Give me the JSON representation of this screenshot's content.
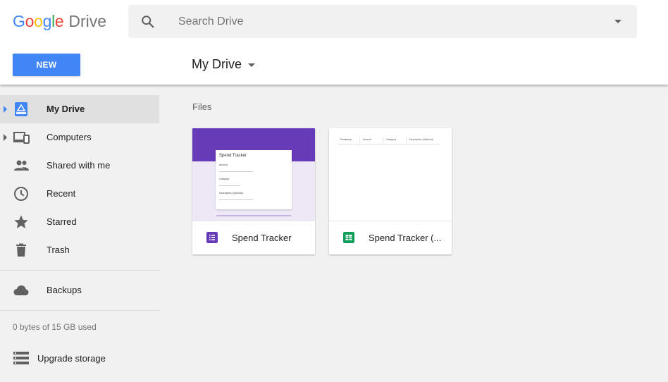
{
  "header": {
    "logo_google": "Google",
    "logo_product": "Drive",
    "search": {
      "placeholder": "Search Drive"
    },
    "new_button": "NEW",
    "location": "My Drive"
  },
  "sidebar": {
    "items": [
      {
        "label": "My Drive",
        "icon": "my-drive-icon",
        "active": true
      },
      {
        "label": "Computers",
        "icon": "computers-icon"
      },
      {
        "label": "Shared with me",
        "icon": "shared-icon"
      },
      {
        "label": "Recent",
        "icon": "clock-icon"
      },
      {
        "label": "Starred",
        "icon": "star-icon"
      },
      {
        "label": "Trash",
        "icon": "trash-icon"
      }
    ],
    "backups": {
      "label": "Backups",
      "icon": "cloud-icon"
    },
    "storage_text": "0 bytes of 15 GB used",
    "upgrade": {
      "label": "Upgrade storage",
      "icon": "storage-icon"
    }
  },
  "main": {
    "section_title": "Files",
    "files": [
      {
        "title": "Spend Tracker",
        "type": "form",
        "icon": "google-forms-icon",
        "icon_color": "#673ab7",
        "preview": {
          "form_title": "Spend Tracker",
          "questions": [
            "Amount",
            "Category",
            "Description (Optional)"
          ]
        }
      },
      {
        "title": "Spend Tracker (...",
        "type": "spreadsheet",
        "icon": "google-sheets-icon",
        "icon_color": "#0f9d58",
        "preview": {
          "columns": [
            "Timestamp",
            "Amount",
            "Category",
            "Description (Optional)"
          ]
        }
      }
    ]
  },
  "colors": {
    "accent": "#4285f4",
    "forms_purple": "#673ab7",
    "sheets_green": "#0f9d58"
  }
}
